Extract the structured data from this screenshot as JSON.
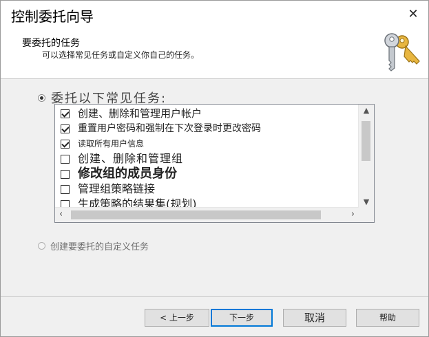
{
  "window": {
    "title": "控制委托向导",
    "close_glyph": "✕"
  },
  "header": {
    "heading": "要委托的任务",
    "description": "可以选择常见任务或自定义你自己的任务。",
    "icon": "keys-icon"
  },
  "options": {
    "common_label": "委托以下常见任务:",
    "custom_label": "创建要委托的自定义任务",
    "selected": "common"
  },
  "tasks": [
    {
      "label": "创建、删除和管理用户帐户",
      "checked": true
    },
    {
      "label": "重置用户密码和强制在下次登录时更改密码",
      "checked": true
    },
    {
      "label": "读取所有用户信息",
      "checked": true
    },
    {
      "label": "创建、删除和管理组",
      "checked": false
    },
    {
      "label": "修改组的成员身份",
      "checked": false
    },
    {
      "label": "管理组策略链接",
      "checked": false
    },
    {
      "label": "生成策略的结果集(规划)",
      "checked": false
    }
  ],
  "scrollbars": {
    "up": "▲",
    "down": "▼",
    "left": "‹",
    "right": "›"
  },
  "buttons": {
    "back": "< 上一步",
    "next": "下一步",
    "cancel": "取消",
    "help": "帮助"
  },
  "colors": {
    "accent": "#0078d7",
    "dialog_bg": "#f0f0f0"
  }
}
